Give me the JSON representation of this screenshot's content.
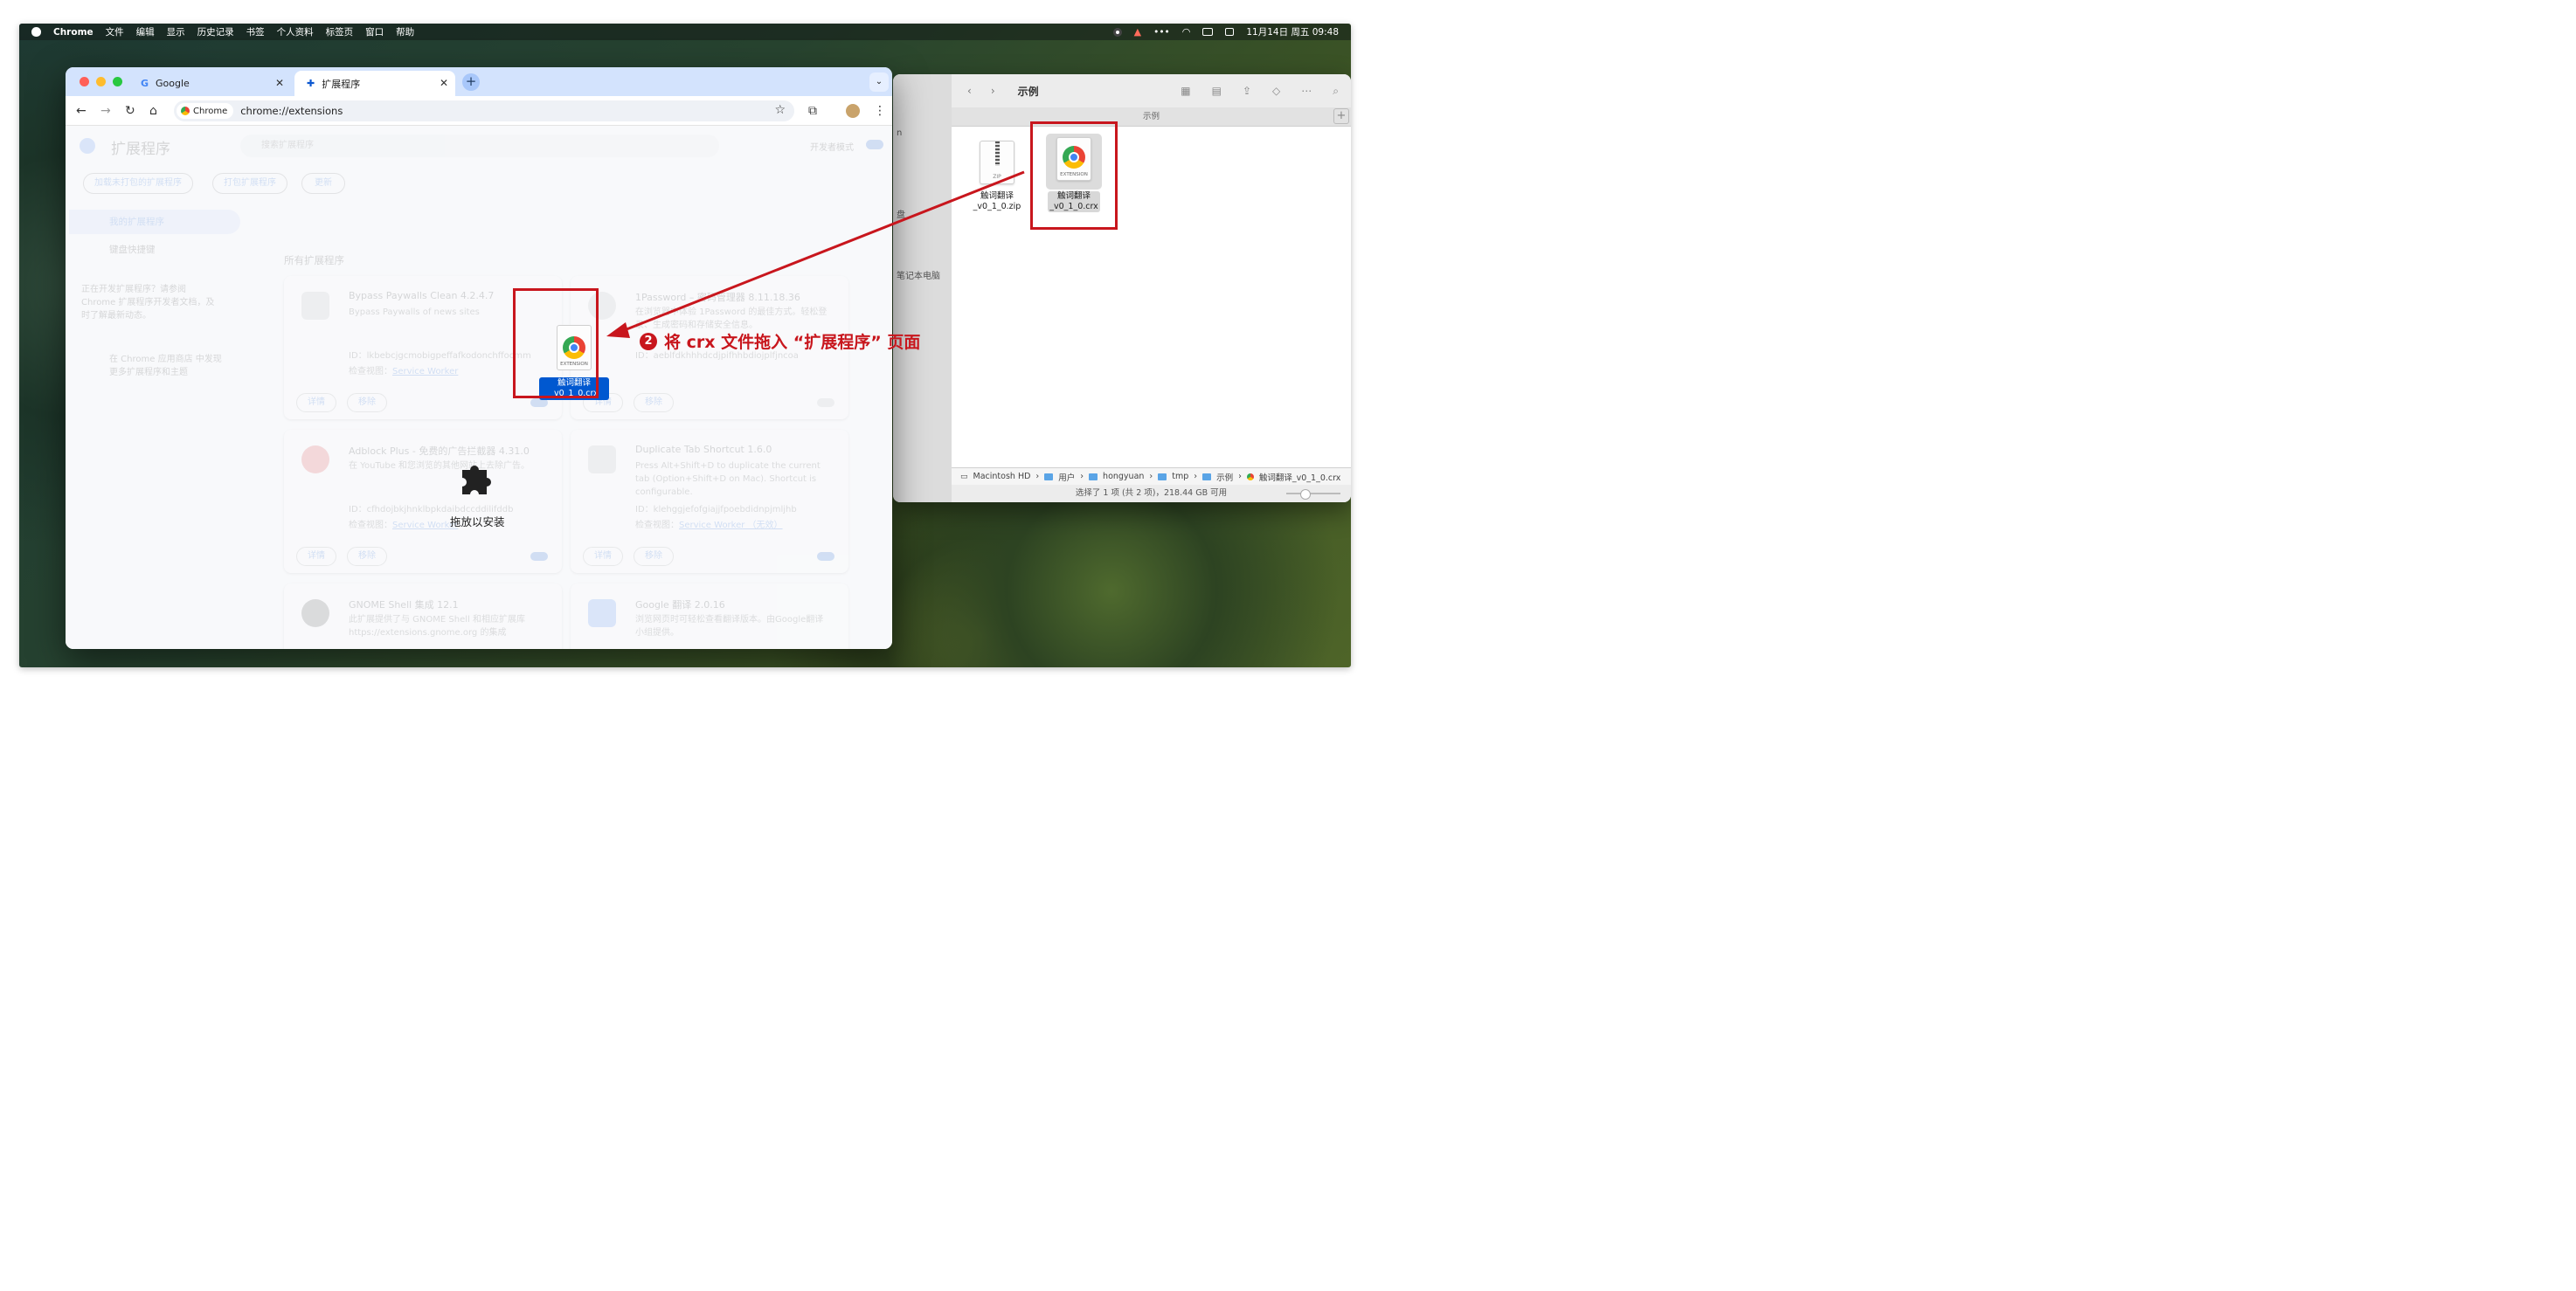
{
  "menubar": {
    "app": "Chrome",
    "items": [
      "文件",
      "编辑",
      "显示",
      "历史记录",
      "书签",
      "个人资料",
      "标签页",
      "窗口",
      "帮助"
    ],
    "clock": "11月14日 周五 09:48"
  },
  "chrome": {
    "tabs": [
      {
        "label": "Google"
      },
      {
        "label": "扩展程序"
      }
    ],
    "chip_label": "Chrome",
    "url": "chrome://extensions",
    "page": {
      "title": "扩展程序",
      "search_placeholder": "搜索扩展程序",
      "dev_mode": "开发者模式",
      "actions": [
        "加载未打包的扩展程序",
        "打包扩展程序",
        "更新"
      ],
      "nav": [
        "我的扩展程序",
        "键盘快捷键"
      ],
      "dev_hint": "正在开发扩展程序？请参阅 Chrome 扩展程序开发者文档，及时了解最新动态。",
      "store_hint": "在 Chrome 应用商店 中发现更多扩展程序和主题",
      "section": "所有扩展程序",
      "cards": [
        {
          "name": "Bypass Paywalls Clean 4.2.4.7",
          "desc": "Bypass Paywalls of news sites",
          "id": "ID：lkbebcjgcmobigpeffafkodonchffocmm",
          "inspect": "检查视图：",
          "worker": "Service Worker"
        },
        {
          "name": "1Password – 密码管理器 8.11.18.36",
          "desc": "在浏览器中体验 1Password 的最佳方式。轻松登录、生成密码和存储安全信息。",
          "id": "ID：aeblfdkhhhdcdjpifhhbdiojplfjncoa",
          "inspect": "",
          "worker": ""
        },
        {
          "name": "Adblock Plus - 免费的广告拦截器 4.31.0",
          "desc": "在 YouTube 和您浏览的其他网站上去除广告。",
          "id": "ID：cfhdojbkjhnklbpkdaibdccddilifddb",
          "inspect": "检查视图：",
          "worker": "Service Worker"
        },
        {
          "name": "Duplicate Tab Shortcut 1.6.0",
          "desc": "Press Alt+Shift+D to duplicate the current tab (Option+Shift+D on Mac). Shortcut is configurable.",
          "id": "ID：klehggjefofgiajjfpoebdidnpjmljhb",
          "inspect": "检查视图：",
          "worker": "Service Worker （无效）"
        },
        {
          "name": "GNOME Shell 集成 12.1",
          "desc": "此扩展提供了与 GNOME Shell 和相应扩展库 https://extensions.gnome.org 的集成",
          "id": "",
          "inspect": "",
          "worker": ""
        },
        {
          "name": "Google 翻译 2.0.16",
          "desc": "浏览网页时可轻松查看翻译版本。由Google翻译小组提供。",
          "id": "",
          "inspect": "",
          "worker": ""
        }
      ],
      "btn_details": "详情",
      "btn_remove": "移除"
    },
    "drop_label": "拖放以安装",
    "drag_file": "触词翻译_v0_1_0.crx"
  },
  "finder": {
    "title": "示例",
    "tab_title": "示例",
    "sidebar_fragments": [
      "n",
      "盘",
      "笔记本电脑"
    ],
    "files": [
      {
        "name": "触词翻译_v0_1_0.zip",
        "type": "ZIP"
      },
      {
        "name": "触词翻译_v0_1_0.crx",
        "type": "EXTENSION"
      }
    ],
    "path": [
      "Macintosh HD",
      "用户",
      "hongyuan",
      "tmp",
      "示例",
      "触词翻译_v0_1_0.crx"
    ],
    "status": "选择了 1 项 (共 2 项)，218.44 GB 可用"
  },
  "annotation": {
    "step": "2",
    "text": "将 crx 文件拖入 “扩展程序” 页面"
  },
  "colors": {
    "highlight": "#c8161d",
    "tabbar": "#d3e3fd",
    "selection": "#0058d0"
  }
}
